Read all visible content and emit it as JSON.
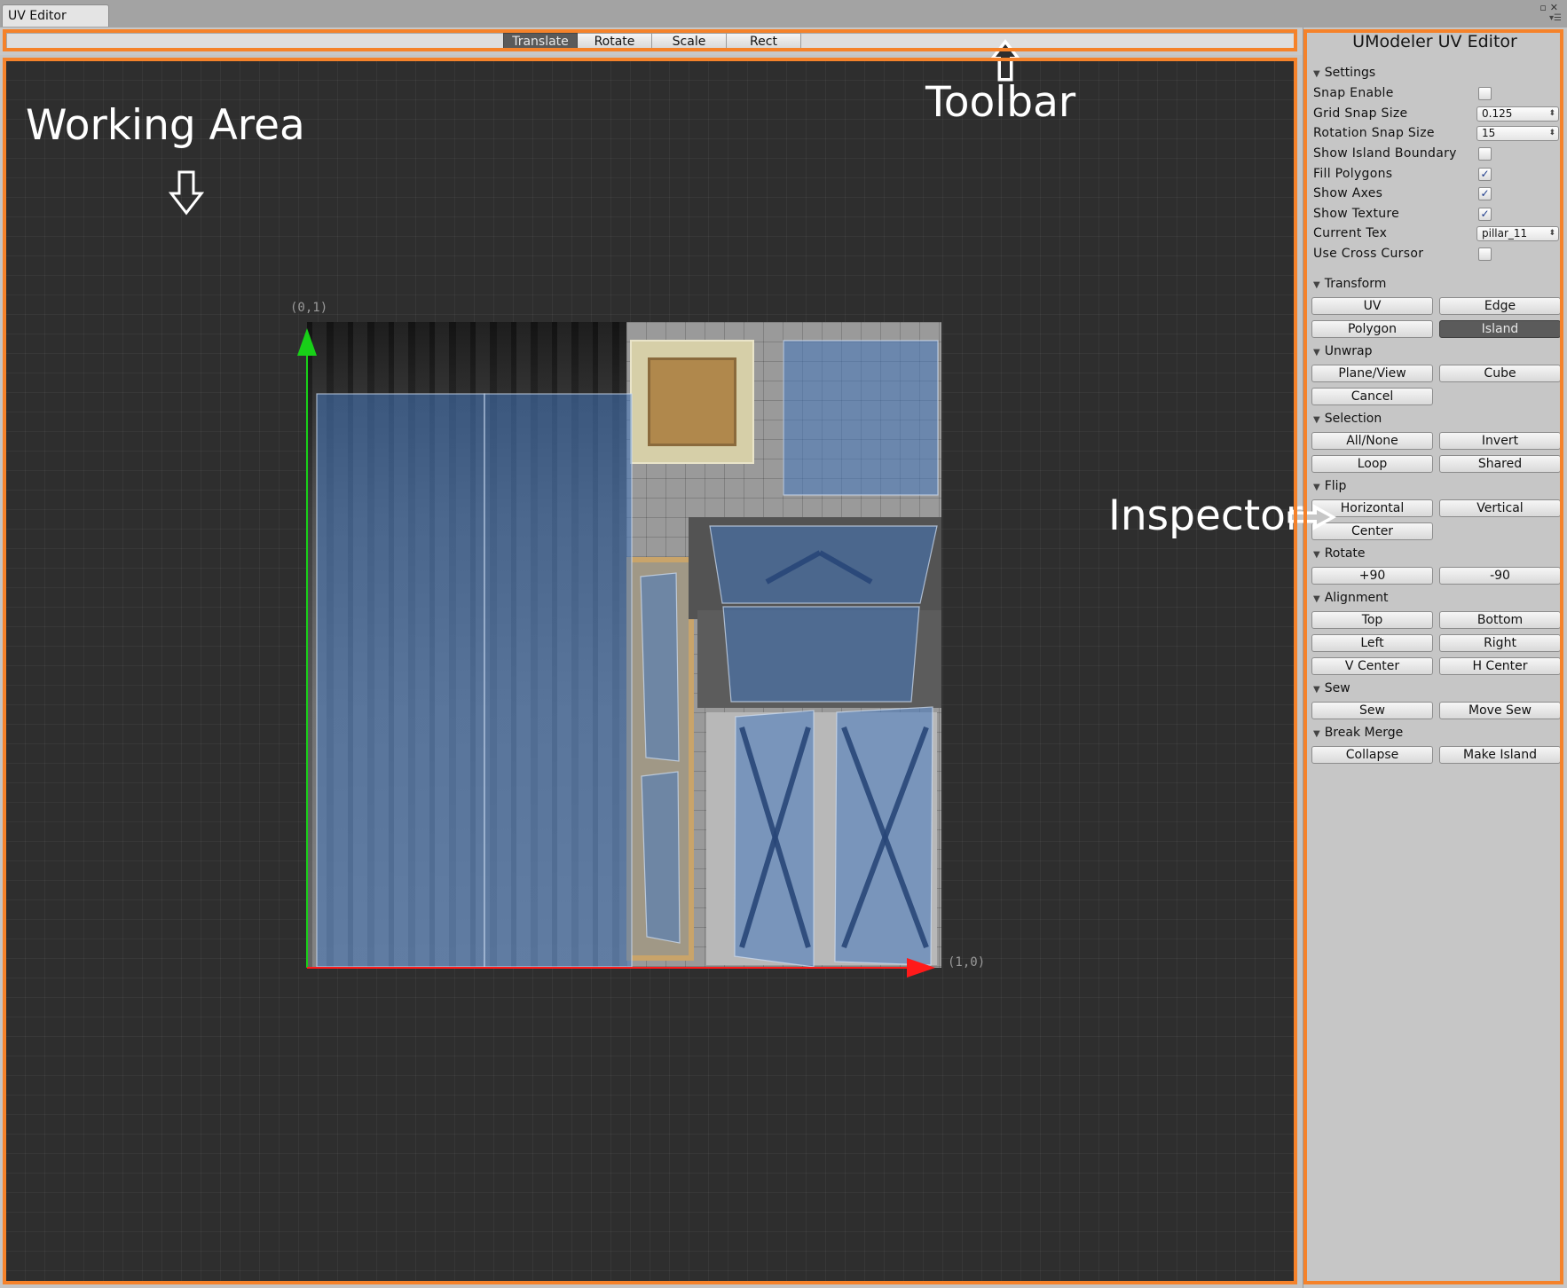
{
  "window": {
    "tab_title": "UV Editor"
  },
  "toolbar": {
    "annotation": "Toolbar",
    "tools": [
      {
        "label": "Translate",
        "active": true
      },
      {
        "label": "Rotate",
        "active": false
      },
      {
        "label": "Scale",
        "active": false
      },
      {
        "label": "Rect",
        "active": false
      }
    ]
  },
  "working_area": {
    "annotation": "Working Area",
    "axis_origin_top_label": "(0,1)",
    "axis_right_label": "(1,0)"
  },
  "inspector": {
    "annotation": "Inspector",
    "title": "UModeler UV Editor",
    "settings": {
      "header": "Settings",
      "snap_enable": "Snap Enable",
      "grid_snap_size": "Grid Snap Size",
      "grid_snap_value": "0.125",
      "rotation_snap_size": "Rotation Snap Size",
      "rotation_snap_value": "15",
      "show_island_boundary": "Show Island Boundary",
      "fill_polygons": "Fill Polygons",
      "show_axes": "Show Axes",
      "show_texture": "Show Texture",
      "current_tex": "Current Tex",
      "current_tex_value": "pillar_11",
      "use_cross_cursor": "Use Cross Cursor",
      "checks": {
        "snap_enable": false,
        "show_island_boundary": false,
        "fill_polygons": true,
        "show_axes": true,
        "show_texture": true,
        "use_cross_cursor": false
      }
    },
    "transform": {
      "header": "Transform",
      "uv": "UV",
      "edge": "Edge",
      "polygon": "Polygon",
      "island": "Island"
    },
    "unwrap": {
      "header": "Unwrap",
      "plane_view": "Plane/View",
      "cube": "Cube",
      "cancel": "Cancel"
    },
    "selection": {
      "header": "Selection",
      "all_none": "All/None",
      "invert": "Invert",
      "loop": "Loop",
      "shared": "Shared"
    },
    "flip": {
      "header": "Flip",
      "horizontal": "Horizontal",
      "vertical": "Vertical",
      "center": "Center"
    },
    "rotate": {
      "header": "Rotate",
      "plus90": "+90",
      "minus90": "-90"
    },
    "alignment": {
      "header": "Alignment",
      "top": "Top",
      "bottom": "Bottom",
      "left": "Left",
      "right": "Right",
      "v_center": "V Center",
      "h_center": "H Center"
    },
    "sew": {
      "header": "Sew",
      "sew": "Sew",
      "move_sew": "Move Sew"
    },
    "break_merge": {
      "header": "Break Merge",
      "collapse": "Collapse",
      "make_island": "Make Island"
    }
  },
  "colors": {
    "highlight_frame": "#f5822a",
    "uv_fill": "#4678be",
    "axis_x": "#ff1a1a",
    "axis_y": "#18d018"
  },
  "icons": {
    "toolbar_arrow": "up-arrow-icon",
    "working_area_arrow": "down-arrow-icon",
    "inspector_arrow": "right-arrow-icon"
  }
}
